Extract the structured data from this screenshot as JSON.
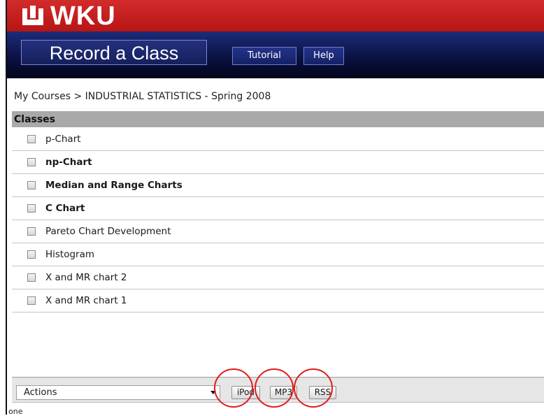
{
  "brand": {
    "logo_text": "WKU",
    "bar_color": "#c71f1f"
  },
  "nav": {
    "app_title": "Record a Class",
    "tutorial_label": "Tutorial",
    "help_label": "Help",
    "bar_color": "#0b1244"
  },
  "breadcrumb": {
    "root": "My Courses",
    "separator": ">",
    "current": "INDUSTRIAL STATISTICS - Spring 2008"
  },
  "classes": {
    "header": "Classes",
    "items": [
      {
        "label": "p-Chart",
        "bold": false,
        "checked": false
      },
      {
        "label": "np-Chart",
        "bold": true,
        "checked": false
      },
      {
        "label": "Median and Range Charts",
        "bold": true,
        "checked": false
      },
      {
        "label": "C Chart",
        "bold": true,
        "checked": false
      },
      {
        "label": "Pareto Chart Development",
        "bold": false,
        "checked": false
      },
      {
        "label": "Histogram",
        "bold": false,
        "checked": false
      },
      {
        "label": "X and MR chart 2",
        "bold": false,
        "checked": false
      },
      {
        "label": "X and MR chart 1",
        "bold": false,
        "checked": false
      }
    ]
  },
  "footer": {
    "actions_value": "Actions",
    "ipod_label": "iPod",
    "mp3_label": "MP3",
    "rss_label": "RSS",
    "highlight_color": "#e01b1b"
  },
  "status_text": "one"
}
